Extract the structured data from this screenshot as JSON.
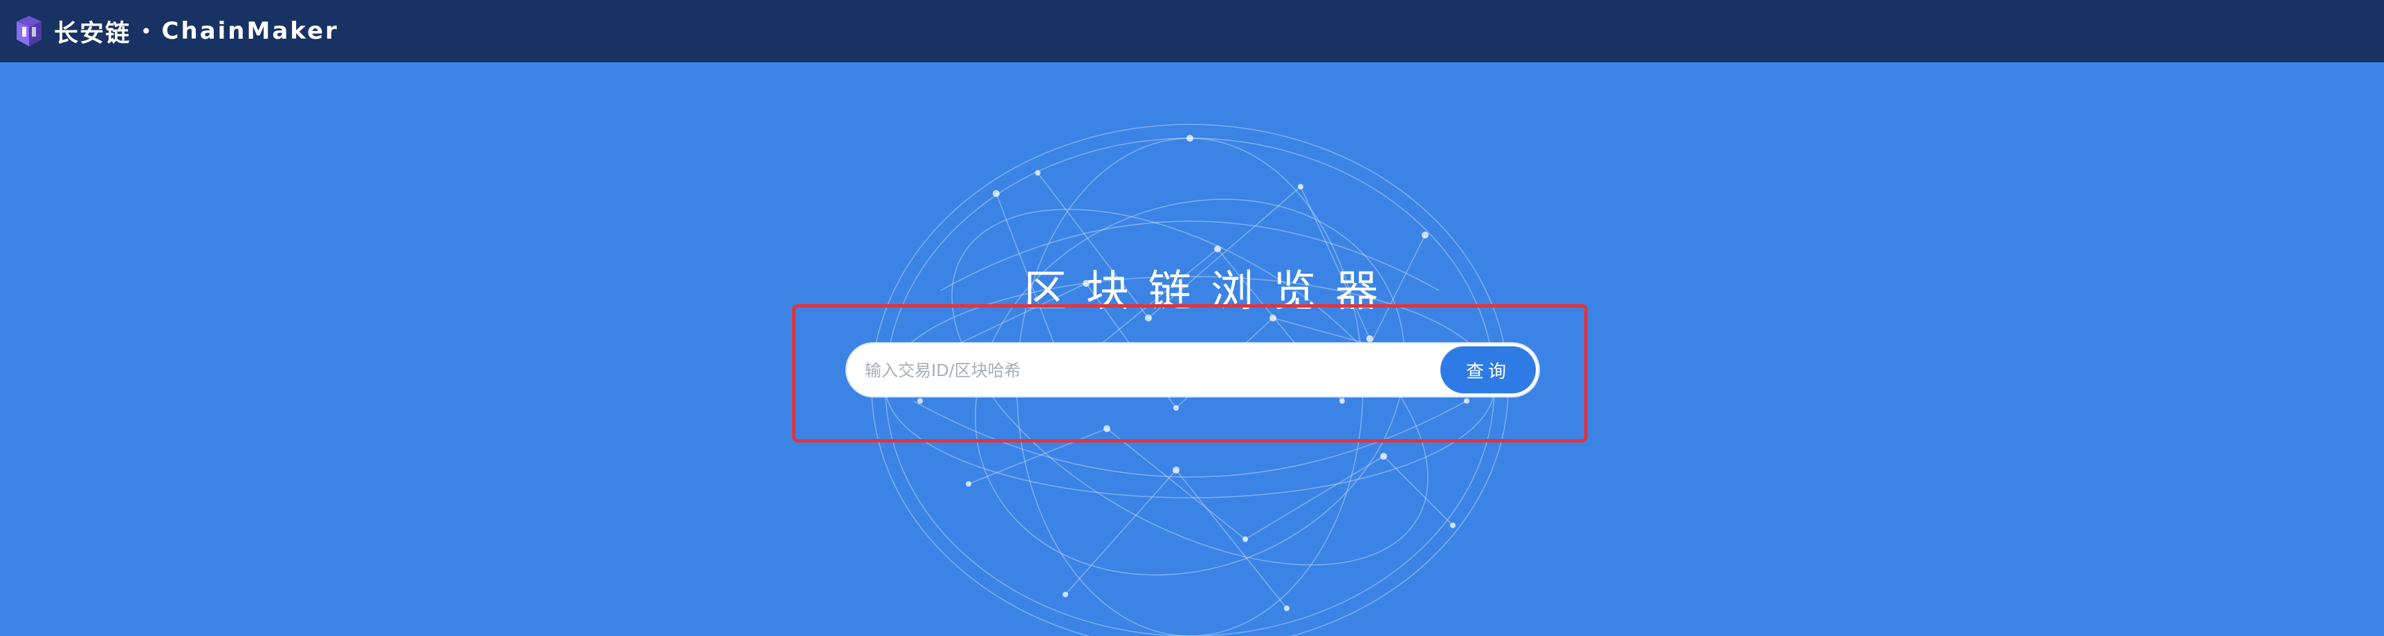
{
  "header": {
    "brand_cn": "长安链",
    "brand_dot": "•",
    "brand_en": "ChainMaker",
    "logo_icon": "cube-logo-icon"
  },
  "hero": {
    "title": "区块链浏览器"
  },
  "search": {
    "placeholder": "输入交易ID/区块哈希",
    "value": "",
    "button_label": "查询"
  },
  "colors": {
    "header_bg": "#183263",
    "page_bg": "#3b84e6",
    "button_bg": "#2f7be6",
    "highlight_border": "#e3343a"
  }
}
